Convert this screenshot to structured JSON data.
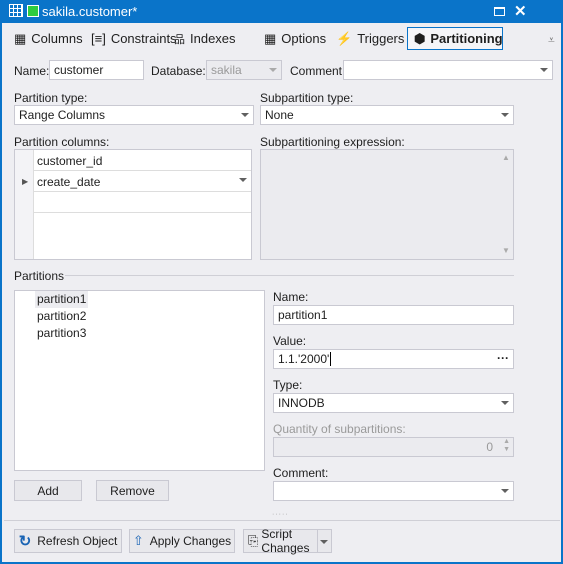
{
  "window": {
    "title": "sakila.customer*",
    "accent": "#0a74c9"
  },
  "tabs": [
    {
      "label": "Columns",
      "icon": "grid-icon"
    },
    {
      "label": "Constraints",
      "icon": "constraint-icon"
    },
    {
      "label": "Indexes",
      "icon": "index-icon"
    },
    {
      "label": "Options",
      "icon": "grid-icon"
    },
    {
      "label": "Triggers",
      "icon": "trigger-icon"
    },
    {
      "label": "Partitioning",
      "icon": "cube-icon",
      "active": true
    }
  ],
  "header": {
    "name_label": "Name:",
    "name_value": "customer",
    "database_label": "Database:",
    "database_value": "sakila",
    "comment_label": "Comment:",
    "comment_value": ""
  },
  "partition_type": {
    "label": "Partition type:",
    "value": "Range Columns"
  },
  "subpartition_type": {
    "label": "Subpartition type:",
    "value": "None"
  },
  "partition_columns": {
    "label": "Partition columns:",
    "rows": [
      "customer_id",
      "create_date",
      ""
    ]
  },
  "subpartitioning_expression": {
    "label": "Subpartitioning expression:",
    "value": ""
  },
  "partitions": {
    "label": "Partitions",
    "items": [
      "partition1",
      "partition2",
      "partition3"
    ],
    "selected": 0,
    "add": "Add",
    "remove": "Remove"
  },
  "details": {
    "name_label": "Name:",
    "name_value": "partition1",
    "value_label": "Value:",
    "value_value": "1.1.'2000'",
    "type_label": "Type:",
    "type_value": "INNODB",
    "quantity_label": "Quantity of subpartitions:",
    "quantity_value": "0",
    "comment_label": "Comment:",
    "comment_value": ""
  },
  "footer": {
    "refresh": "Refresh Object",
    "apply": "Apply Changes",
    "script": "Script Changes"
  }
}
